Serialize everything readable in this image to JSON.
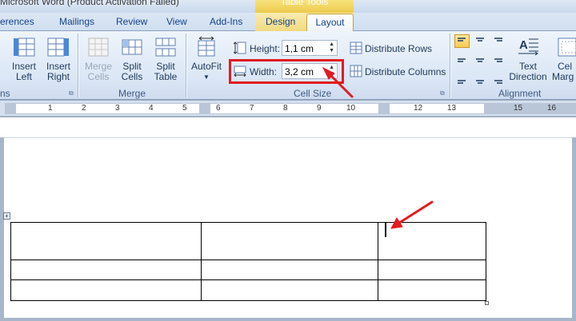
{
  "window": {
    "title": "Microsoft Word (Product Activation Failed)",
    "context_tab_group": "Table Tools"
  },
  "tabs": [
    "erences",
    "Mailings",
    "Review",
    "View",
    "Add-Ins",
    "Design",
    "Layout"
  ],
  "active_tab": "Layout",
  "ribbon": {
    "rows_columns": {
      "insert_left": [
        "Insert",
        "Left"
      ],
      "insert_right": [
        "Insert",
        "Right"
      ],
      "group_label": "ns"
    },
    "merge": {
      "merge_cells": [
        "Merge",
        "Cells"
      ],
      "split_cells": [
        "Split",
        "Cells"
      ],
      "split_table": [
        "Split",
        "Table"
      ],
      "group_label": "Merge"
    },
    "cell_size": {
      "autofit": "AutoFit",
      "height_label": "Height:",
      "height_value": "1,1 cm",
      "width_label": "Width:",
      "width_value": "3,2 cm",
      "distribute_rows": "Distribute Rows",
      "distribute_columns": "Distribute Columns",
      "group_label": "Cell Size"
    },
    "alignment": {
      "text_direction": [
        "Text",
        "Direction"
      ],
      "cell_margins": [
        "Cel",
        "Marg"
      ],
      "group_label": "Alignment"
    }
  },
  "ruler": {
    "numbers": [
      "1",
      "2",
      "3",
      "4",
      "5",
      "6",
      "7",
      "8",
      "9",
      "10",
      "12",
      "13",
      "15",
      "16"
    ]
  },
  "colors": {
    "annotation": "#e11b22",
    "tab_active_border": "#c5a232",
    "table_tools": "#edc94b"
  }
}
